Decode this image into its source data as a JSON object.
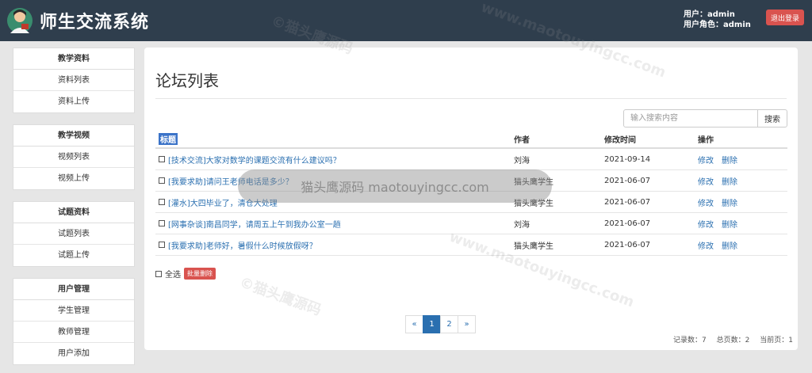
{
  "header": {
    "title": "师生交流系统",
    "user_label": "用户：admin",
    "role_label": "用户角色：admin",
    "logout_label": "退出登录"
  },
  "sidebar": {
    "groups": [
      {
        "title": "教学资料",
        "items": [
          "资料列表",
          "资料上传"
        ]
      },
      {
        "title": "教学视频",
        "items": [
          "视频列表",
          "视频上传"
        ]
      },
      {
        "title": "试题资料",
        "items": [
          "试题列表",
          "试题上传"
        ]
      },
      {
        "title": "用户管理",
        "items": [
          "学生管理",
          "教师管理",
          "用户添加"
        ]
      }
    ]
  },
  "main": {
    "page_title": "论坛列表",
    "search": {
      "placeholder": "输入搜索内容",
      "button_label": "搜索"
    },
    "table": {
      "headers": {
        "title": "标题",
        "author": "作者",
        "time": "修改时间",
        "ops": "操作"
      },
      "rows": [
        {
          "title": "[技术交流]大家对数学的课题交流有什么建议吗？",
          "author": "刘海",
          "time": "2021-09-14",
          "edit": "修改",
          "delete": "删除"
        },
        {
          "title": "[我要求助]请问王老师电话是多少？",
          "author": "猫头鹰学生",
          "time": "2021-06-07",
          "edit": "修改",
          "delete": "删除"
        },
        {
          "title": "[灌水]大四毕业了，清仓大处理",
          "author": "猫头鹰学生",
          "time": "2021-06-07",
          "edit": "修改",
          "delete": "删除"
        },
        {
          "title": "[网事杂谈]南昌同学，请周五上午到我办公室一趟",
          "author": "刘海",
          "time": "2021-06-07",
          "edit": "修改",
          "delete": "删除"
        },
        {
          "title": "[我要求助]老师好，暑假什么时候放假呀？",
          "author": "猫头鹰学生",
          "time": "2021-06-07",
          "edit": "修改",
          "delete": "删除"
        }
      ]
    },
    "select_all_label": "全选",
    "batch_delete_label": "批量删除",
    "pager": {
      "prev": "«",
      "pages": [
        "1",
        "2"
      ],
      "next": "»",
      "active": "1"
    },
    "stats": {
      "records": "记录数：7",
      "total_pages": "总页数：2",
      "current_page": "当前页：1"
    }
  },
  "watermark": {
    "logo_text": "©猫头鹰源码",
    "url_text": "www.maotouyingcc.com",
    "bar_text": "猫头鹰源码 maotouyingcc.com"
  },
  "colors": {
    "header_bg": "#2f3e4d",
    "danger": "#d9534f",
    "link": "#2a6fb0"
  }
}
